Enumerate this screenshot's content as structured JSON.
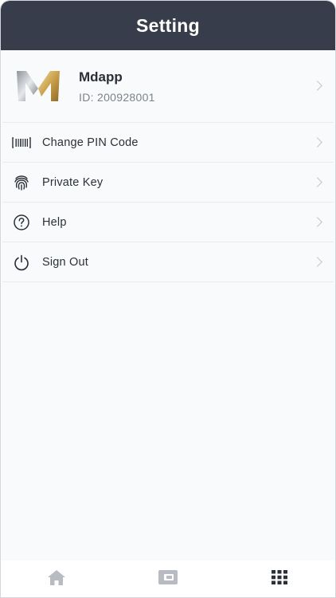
{
  "header": {
    "title": "Setting"
  },
  "profile": {
    "name": "Mdapp",
    "id_text": "ID: 200928001",
    "logo_icon": "mdapp-logo"
  },
  "menu": {
    "items": [
      {
        "label": "Change PIN Code",
        "icon": "barcode-icon"
      },
      {
        "label": "Private Key",
        "icon": "fingerprint-icon"
      },
      {
        "label": "Help",
        "icon": "help-icon"
      },
      {
        "label": "Sign Out",
        "icon": "power-icon"
      }
    ]
  },
  "bottom_nav": {
    "items": [
      {
        "icon": "home-icon",
        "active": false
      },
      {
        "icon": "wallet-icon",
        "active": false
      },
      {
        "icon": "grid-icon",
        "active": true
      }
    ]
  },
  "colors": {
    "header_bg": "#383d4b",
    "nav_inactive": "#b8bcc2",
    "nav_active": "#2b2f38"
  }
}
